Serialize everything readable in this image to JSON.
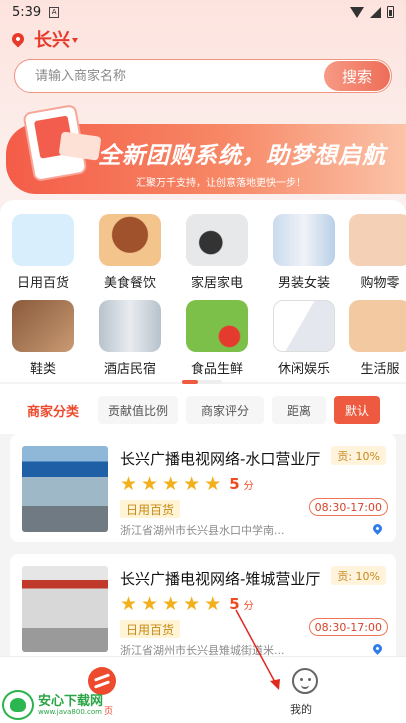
{
  "status_bar": {
    "time": "5:39",
    "notification_icon": "a-box-icon"
  },
  "location": {
    "city": "长兴"
  },
  "search": {
    "placeholder": "请输入商家名称",
    "button_label": "搜索"
  },
  "banner": {
    "title": "全新团购系统，助梦想启航",
    "subtitle": "汇聚万千支持，让创意落地更快一步！"
  },
  "categories": [
    {
      "label": "日用百货",
      "color": "#d8eefc"
    },
    {
      "label": "美食餐饮",
      "color": "#f3c58c"
    },
    {
      "label": "家居家电",
      "color": "#e6e8ea"
    },
    {
      "label": "男装女装",
      "color": "#dbe8f4"
    },
    {
      "label": "购物零",
      "color": "#f4d0b6"
    },
    {
      "label": "鞋类",
      "color": "#c99a73"
    },
    {
      "label": "酒店民宿",
      "color": "#d9dfe6"
    },
    {
      "label": "食品生鲜",
      "color": "#9fd46a"
    },
    {
      "label": "休闲娱乐",
      "color": "#e4e7ee"
    },
    {
      "label": "生活服",
      "color": "#f2c9a0"
    }
  ],
  "filters": [
    {
      "label": "商家分类",
      "state": "active"
    },
    {
      "label": "贡献值比例",
      "state": "normal"
    },
    {
      "label": "商家评分",
      "state": "normal"
    },
    {
      "label": "距离",
      "state": "normal"
    },
    {
      "label": "默认",
      "state": "selected"
    }
  ],
  "stores": [
    {
      "name": "长兴广播电视网络-水口营业厅",
      "rating": 5,
      "score": "5",
      "score_unit": "分",
      "category": "日用百货",
      "commission": "贡: 10%",
      "hours": "08:30-17:00",
      "address": "浙江省湖州市长兴县水口中学南..."
    },
    {
      "name": "长兴广播电视网络-雉城营业厅",
      "rating": 5,
      "score": "5",
      "score_unit": "分",
      "category": "日用百货",
      "commission": "贡: 10%",
      "hours": "08:30-17:00",
      "address": "浙江省湖州市长兴县雉城街道米..."
    }
  ],
  "bottom_nav": {
    "home_label": "",
    "me_label": "我的"
  },
  "watermark": {
    "brand": "安心下载网",
    "url": "www.java800.com",
    "side_char": "页"
  },
  "colors": {
    "accent": "#ee4a2e",
    "star": "#f2b01c",
    "link_blue": "#2e7de8"
  }
}
